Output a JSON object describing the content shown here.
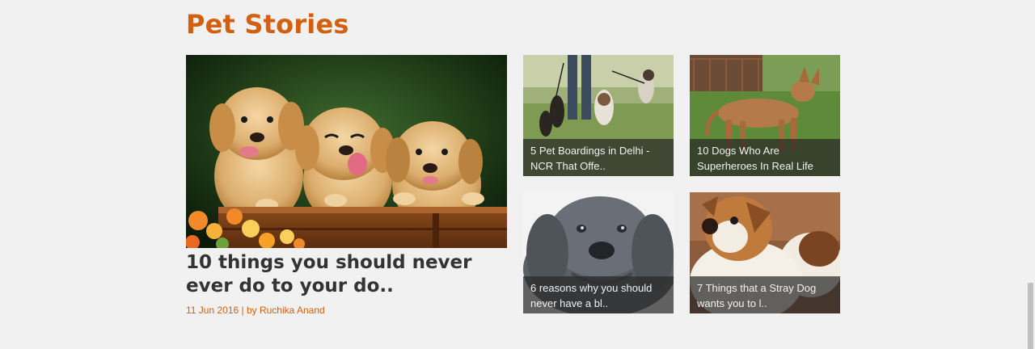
{
  "section": {
    "title": "Pet Stories"
  },
  "featured": {
    "image_alt": "three golden retriever puppies in a wooden crate with flowers",
    "title": "10 things you should never ever do to your do..",
    "meta": "11 Jun 2016 | by Ruchika Anand"
  },
  "cards": [
    {
      "caption": "5 Pet Boardings in Delhi - NCR That Offe..",
      "image": "dogs-walking-on-leashes"
    },
    {
      "caption": "10 Dogs Who Are Superheroes In Real Life",
      "image": "tan-dog-on-grass"
    },
    {
      "caption": "6 reasons why you should never have a bl..",
      "image": "grey-mastiff-puppy"
    },
    {
      "caption": "7 Things that a Stray Dog wants you to l..",
      "image": "two-jack-russell-dogs"
    }
  ],
  "colors": {
    "accent": "#d35f11",
    "headline": "#333333",
    "background": "#f1f1f1"
  }
}
